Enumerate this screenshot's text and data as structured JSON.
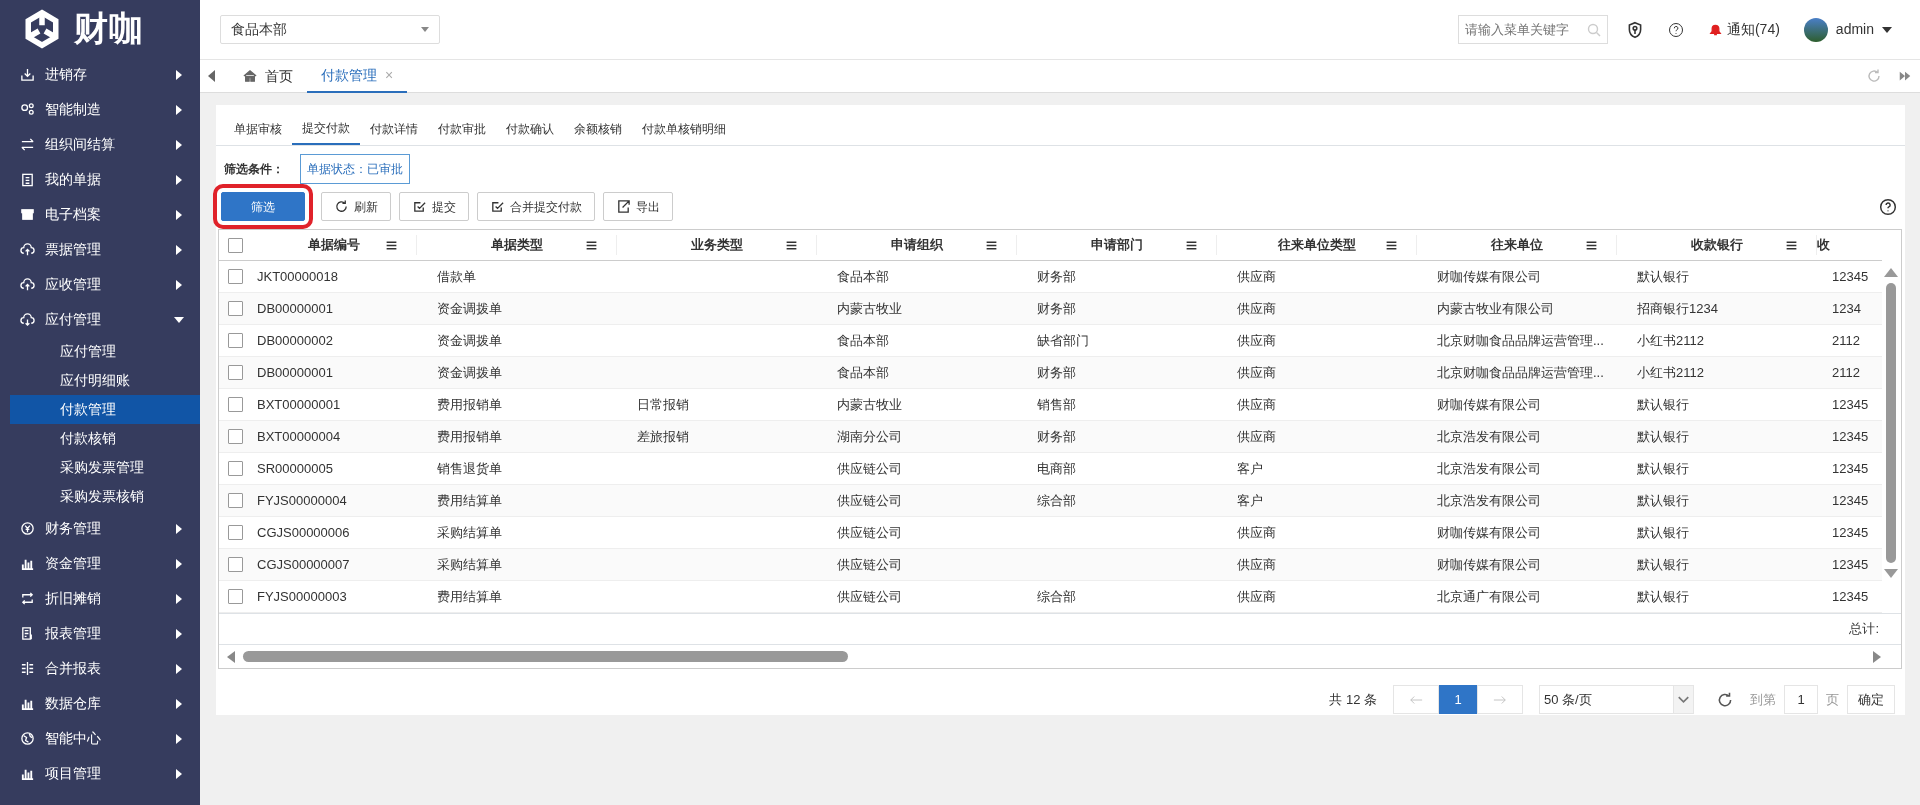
{
  "logo_text": "财咖",
  "sidebar": {
    "items": [
      {
        "label": "进销存",
        "expanded": false
      },
      {
        "label": "智能制造",
        "expanded": false
      },
      {
        "label": "组织间结算",
        "expanded": false
      },
      {
        "label": "我的单据",
        "expanded": false
      },
      {
        "label": "电子档案",
        "expanded": false
      },
      {
        "label": "票据管理",
        "expanded": false
      },
      {
        "label": "应收管理",
        "expanded": false
      },
      {
        "label": "应付管理",
        "expanded": true,
        "children": [
          {
            "label": "应付管理",
            "selected": false
          },
          {
            "label": "应付明细账",
            "selected": false
          },
          {
            "label": "付款管理",
            "selected": true
          },
          {
            "label": "付款核销",
            "selected": false
          },
          {
            "label": "采购发票管理",
            "selected": false
          },
          {
            "label": "采购发票核销",
            "selected": false
          }
        ]
      },
      {
        "label": "财务管理",
        "expanded": false
      },
      {
        "label": "资金管理",
        "expanded": false
      },
      {
        "label": "折旧摊销",
        "expanded": false
      },
      {
        "label": "报表管理",
        "expanded": false
      },
      {
        "label": "合并报表",
        "expanded": false
      },
      {
        "label": "数据仓库",
        "expanded": false
      },
      {
        "label": "智能中心",
        "expanded": false
      },
      {
        "label": "项目管理",
        "expanded": false
      }
    ]
  },
  "header": {
    "org_select": "食品本部",
    "search": {
      "placeholder": "请输入菜单关键字"
    },
    "notifications": "通知(74)",
    "user": "admin"
  },
  "page_tabs": [
    {
      "label": "首页",
      "selected": false
    },
    {
      "label": "付款管理",
      "selected": true,
      "close": "×"
    }
  ],
  "sub_tabs": [
    {
      "label": "单据审核",
      "selected": false
    },
    {
      "label": "提交付款",
      "selected": true
    },
    {
      "label": "付款详情",
      "selected": false
    },
    {
      "label": "付款审批",
      "selected": false
    },
    {
      "label": "付款确认",
      "selected": false
    },
    {
      "label": "余额核销",
      "selected": false
    },
    {
      "label": "付款单核销明细",
      "selected": false
    }
  ],
  "filter": {
    "label": "筛选条件：",
    "chip": "单据状态：已审批"
  },
  "toolbar": [
    {
      "label": "筛选",
      "kind": "primary",
      "highlighted": true
    },
    {
      "label": "刷新",
      "kind": "refresh",
      "highlighted": false
    },
    {
      "label": "提交",
      "kind": "check",
      "highlighted": false
    },
    {
      "label": "合并提交付款",
      "kind": "check",
      "highlighted": false
    },
    {
      "label": "导出",
      "kind": "export",
      "highlighted": false
    }
  ],
  "table": {
    "all_checked": false,
    "columns": [
      "单据编号",
      "单据类型",
      "业务类型",
      "申请组织",
      "申请部门",
      "往来单位类型",
      "往来单位",
      "收款银行",
      "收"
    ],
    "rows": [
      {
        "checked": false,
        "cells": [
          "JKT00000018",
          "借款单",
          null,
          "食品本部",
          "财务部",
          "供应商",
          "财咖传媒有限公司",
          "默认银行",
          "12345"
        ]
      },
      {
        "checked": false,
        "cells": [
          "DB00000001",
          "资金调拨单",
          null,
          "内蒙古牧业",
          "财务部",
          "供应商",
          "内蒙古牧业有限公司",
          "招商银行1234",
          "1234"
        ]
      },
      {
        "checked": false,
        "cells": [
          "DB00000002",
          "资金调拨单",
          null,
          "食品本部",
          "缺省部门",
          "供应商",
          "北京财咖食品品牌运营管理...",
          "小红书2112",
          "2112"
        ]
      },
      {
        "checked": false,
        "cells": [
          "DB00000001",
          "资金调拨单",
          null,
          "食品本部",
          "财务部",
          "供应商",
          "北京财咖食品品牌运营管理...",
          "小红书2112",
          "2112"
        ]
      },
      {
        "checked": false,
        "cells": [
          "BXT00000001",
          "费用报销单",
          "日常报销",
          "内蒙古牧业",
          "销售部",
          "供应商",
          "财咖传媒有限公司",
          "默认银行",
          "12345"
        ]
      },
      {
        "checked": false,
        "cells": [
          "BXT00000004",
          "费用报销单",
          "差旅报销",
          "湖南分公司",
          "财务部",
          "供应商",
          "北京浩发有限公司",
          "默认银行",
          "12345"
        ]
      },
      {
        "checked": false,
        "cells": [
          "SR00000005",
          "销售退货单",
          null,
          "供应链公司",
          "电商部",
          "客户",
          "北京浩发有限公司",
          "默认银行",
          "12345"
        ]
      },
      {
        "checked": false,
        "cells": [
          "FYJS00000004",
          "费用结算单",
          null,
          "供应链公司",
          "综合部",
          "客户",
          "北京浩发有限公司",
          "默认银行",
          "12345"
        ]
      },
      {
        "checked": false,
        "cells": [
          "CGJS00000006",
          "采购结算单",
          null,
          "供应链公司",
          null,
          "供应商",
          "财咖传媒有限公司",
          "默认银行",
          "12345"
        ]
      },
      {
        "checked": false,
        "cells": [
          "CGJS00000007",
          "采购结算单",
          null,
          "供应链公司",
          null,
          "供应商",
          "财咖传媒有限公司",
          "默认银行",
          "12345"
        ]
      },
      {
        "checked": false,
        "cells": [
          "FYJS00000003",
          "费用结算单",
          null,
          "供应链公司",
          "综合部",
          "供应商",
          "北京通广有限公司",
          "默认银行",
          "12345"
        ]
      }
    ],
    "total_label": "总计:"
  },
  "pagination": {
    "total": "共 12 条",
    "pages": [
      {
        "label": "1",
        "selected": true
      }
    ],
    "page_size": "50 条/页",
    "goto_label": "到第",
    "goto_value": "1",
    "page_unit": "页",
    "confirm": "确定"
  }
}
